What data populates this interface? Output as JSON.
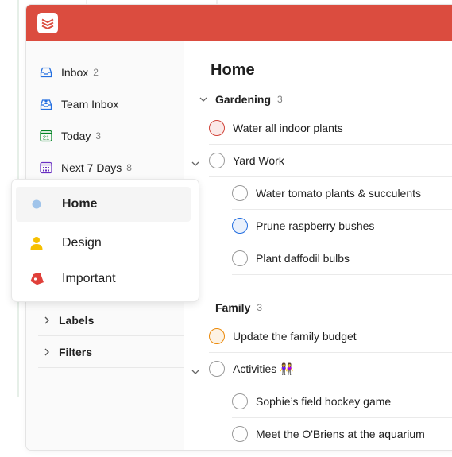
{
  "sidebar": {
    "items": [
      {
        "label": "Inbox",
        "count": "2",
        "icon": "inbox-icon"
      },
      {
        "label": "Team Inbox",
        "count": "",
        "icon": "team-inbox-icon"
      },
      {
        "label": "Today",
        "count": "3",
        "icon": "today-calendar-icon",
        "day": "21"
      },
      {
        "label": "Next 7 Days",
        "count": "8",
        "icon": "upcoming-calendar-icon"
      }
    ],
    "sections": [
      {
        "label": "Labels"
      },
      {
        "label": "Filters"
      }
    ]
  },
  "popup": {
    "items": [
      {
        "label": "Home",
        "icon": "blue-dot-icon"
      },
      {
        "label": "Design",
        "icon": "person-icon"
      },
      {
        "label": "Important",
        "icon": "tag-icon"
      }
    ]
  },
  "main": {
    "title": "Home",
    "sections": [
      {
        "name": "Gardening",
        "count": "3",
        "tasks": [
          {
            "title": "Water all indoor plants"
          },
          {
            "title": "Yard Work"
          },
          {
            "title": "Water tomato plants & succulents"
          },
          {
            "title": "Prune raspberry bushes"
          },
          {
            "title": "Plant daffodil bulbs"
          }
        ]
      },
      {
        "name": "Family",
        "count": "3",
        "tasks": [
          {
            "title": "Update the family budget"
          },
          {
            "title": "Activities 👭"
          },
          {
            "title": "Sophie’s field hockey game"
          },
          {
            "title": "Meet the O'Briens at the aquarium"
          }
        ]
      }
    ]
  },
  "colors": {
    "brand_red": "#db4c3f",
    "priority1": "#d1453b",
    "priority2": "#eb8909",
    "priority3": "#246fe0",
    "label_blue": "#a0c4ea",
    "label_yellow": "#f6c000",
    "label_red": "#e0403a"
  }
}
